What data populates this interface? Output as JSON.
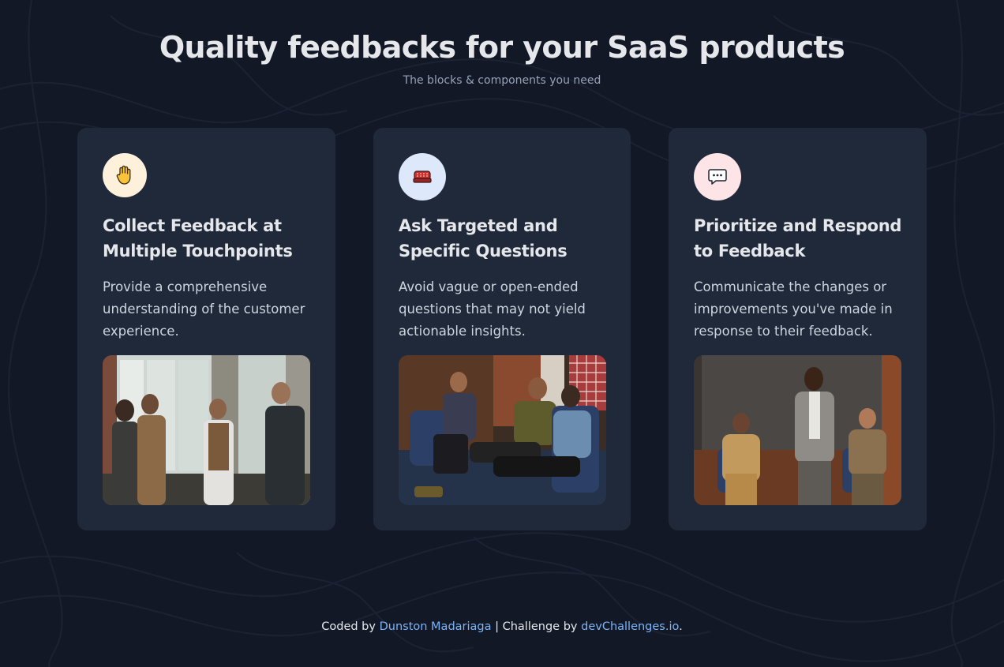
{
  "hero": {
    "title": "Quality feedbacks for your SaaS products",
    "subtitle": "The blocks & components you need"
  },
  "cards": [
    {
      "icon": "raised-hand-icon",
      "icon_bg": "#fdf1dc",
      "title": "Collect Feedback at Multiple Touchpoints",
      "text": "Provide a comprehensive understanding of the customer experience.",
      "image": "people-standing-discussion-photo"
    },
    {
      "icon": "audience-seats-icon",
      "icon_bg": "#dde9fb",
      "title": "Ask Targeted and Specific Questions",
      "text": "Avoid vague or open-ended questions that may not yield actionable insights.",
      "image": "seated-group-discussion-photo"
    },
    {
      "icon": "speech-bubble-icon",
      "icon_bg": "#fde4e6",
      "title": "Prioritize and Respond to Feedback",
      "text": "Communicate the changes or improvements you've made in response to their feedback.",
      "image": "speaker-panel-photo"
    }
  ],
  "footer": {
    "prefix": "Coded by ",
    "author": "Dunston Madariaga",
    "separator": " | Challenge by ",
    "challenge": "devChallenges.io",
    "suffix": "."
  },
  "colors": {
    "background": "#121826",
    "card": "#20293a",
    "link": "#7cb4f7",
    "subtitle": "#97a3b6"
  }
}
